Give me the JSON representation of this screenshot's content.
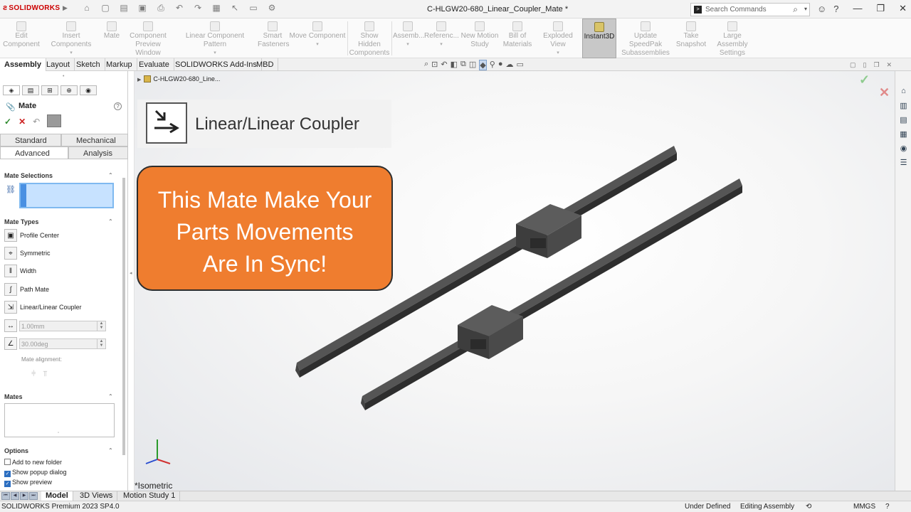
{
  "title_bar": {
    "app_name": "SOLIDWORKS",
    "document_title": "C-HLGW20-680_Linear_Coupler_Mate *",
    "search_placeholder": "Search Commands"
  },
  "command_manager": {
    "items": [
      {
        "label": "Edit Component",
        "active": false
      },
      {
        "label": "Insert Components",
        "active": false
      },
      {
        "label": "Mate",
        "active": false
      },
      {
        "label": "Component Preview Window",
        "active": false
      },
      {
        "label": "Linear Component Pattern",
        "active": false
      },
      {
        "label": "Smart Fasteners",
        "active": false
      },
      {
        "label": "Move Component",
        "active": false
      },
      {
        "label": "Show Hidden Components",
        "active": false
      },
      {
        "label": "Assemb...",
        "active": false
      },
      {
        "label": "Referenc...",
        "active": false
      },
      {
        "label": "New Motion Study",
        "active": false
      },
      {
        "label": "Bill of Materials",
        "active": false
      },
      {
        "label": "Exploded View",
        "active": false
      },
      {
        "label": "Instant3D",
        "active": true
      },
      {
        "label": "Update SpeedPak Subassemblies",
        "active": false
      },
      {
        "label": "Take Snapshot",
        "active": false
      },
      {
        "label": "Large Assembly Settings",
        "active": false
      }
    ]
  },
  "ribbon_tabs": [
    "Assembly",
    "Layout",
    "Sketch",
    "Markup",
    "Evaluate",
    "SOLIDWORKS Add-Ins",
    "MBD"
  ],
  "property_manager": {
    "title": "Mate",
    "tabs": [
      "Standard",
      "Mechanical",
      "Advanced",
      "Analysis"
    ],
    "sections": {
      "mate_selections": "Mate Selections",
      "mate_types": "Mate Types",
      "mates": "Mates",
      "options": "Options"
    },
    "mate_types": [
      "Profile Center",
      "Symmetric",
      "Width",
      "Path Mate",
      "Linear/Linear Coupler"
    ],
    "distance_value": "1.00mm",
    "angle_value": "30.00deg",
    "mate_alignment_label": "Mate alignment:",
    "options": [
      {
        "label": "Add to new folder",
        "checked": false
      },
      {
        "label": "Show popup dialog",
        "checked": true
      },
      {
        "label": "Show preview",
        "checked": true
      }
    ]
  },
  "feature_tree": {
    "root": "C-HLGW20-680_Line..."
  },
  "viewport": {
    "banner_title": "Linear/Linear Coupler",
    "callout_lines": [
      "This Mate Make Your",
      "Parts Movements",
      "Are In Sync!"
    ],
    "view_label": "*Isometric",
    "callout_color": "#EF7D2F"
  },
  "bottom_tabs": [
    "Model",
    "3D Views",
    "Motion Study 1"
  ],
  "status_bar": {
    "product": "SOLIDWORKS Premium 2023 SP4.0",
    "state": "Under Defined",
    "mode": "Editing Assembly",
    "units": "MMGS"
  }
}
